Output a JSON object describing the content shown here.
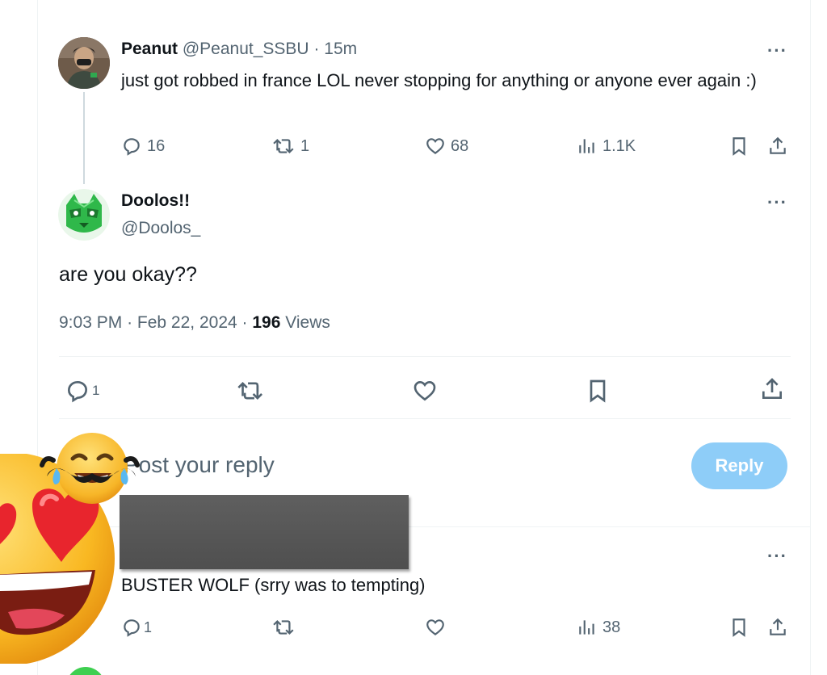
{
  "colors": {
    "accent": "#1d9bf0",
    "reply_button": "#8ecdf8",
    "muted": "#536471",
    "text": "#0f1419",
    "divider": "#eff3f4"
  },
  "parent_tweet": {
    "author_name": "Peanut",
    "handle": "@Peanut_SSBU",
    "separator": "·",
    "time": "15m",
    "text": "just got robbed in france LOL never stopping for anything or anyone ever again :)",
    "stats": {
      "replies": "16",
      "reposts": "1",
      "likes": "68",
      "views": "1.1K"
    }
  },
  "main_tweet": {
    "author_name": "Doolos!!",
    "handle": "@Doolos_",
    "text": "are you okay??",
    "time": "9:03 PM",
    "date": "Feb 22, 2024",
    "separator": "·",
    "views_count": "196",
    "views_label": "Views",
    "stats": {
      "replies": "1"
    }
  },
  "composer": {
    "placeholder": "Post your reply",
    "button_label": "Reply"
  },
  "reply_tweet": {
    "text": "BUSTER WOLF (srry was to tempting)",
    "stats": {
      "replies": "1",
      "views": "38"
    }
  },
  "icons": {
    "more": "more-icon",
    "reply": "reply-icon",
    "repost": "repost-icon",
    "like": "heart-icon",
    "views": "views-icon",
    "bookmark": "bookmark-icon",
    "share": "share-icon",
    "sticker_1": "heart-eyes-emoji",
    "sticker_2": "laughing-mustache-emoji"
  },
  "more_glyph": "···"
}
